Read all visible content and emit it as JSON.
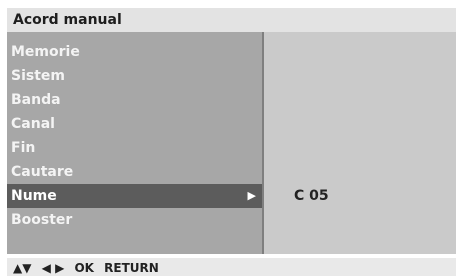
{
  "window": {
    "title": "Acord manual"
  },
  "menu": {
    "items": [
      {
        "label": "Memorie"
      },
      {
        "label": "Sistem"
      },
      {
        "label": "Banda"
      },
      {
        "label": "Canal"
      },
      {
        "label": "Fin"
      },
      {
        "label": "Cautare"
      },
      {
        "label": "Nume",
        "selected": true
      },
      {
        "label": "Booster"
      }
    ],
    "selected_arrow": "▶"
  },
  "detail": {
    "value": "C 05"
  },
  "footer": {
    "updown": "▲▼",
    "leftright": "◀ ▶",
    "ok": "OK",
    "return": "RETURN"
  },
  "colors": {
    "title_bar": "#e3e3e3",
    "left_panel": "#a7a7a7",
    "right_panel": "#cacaca",
    "selected_row": "#5c5c5c"
  }
}
